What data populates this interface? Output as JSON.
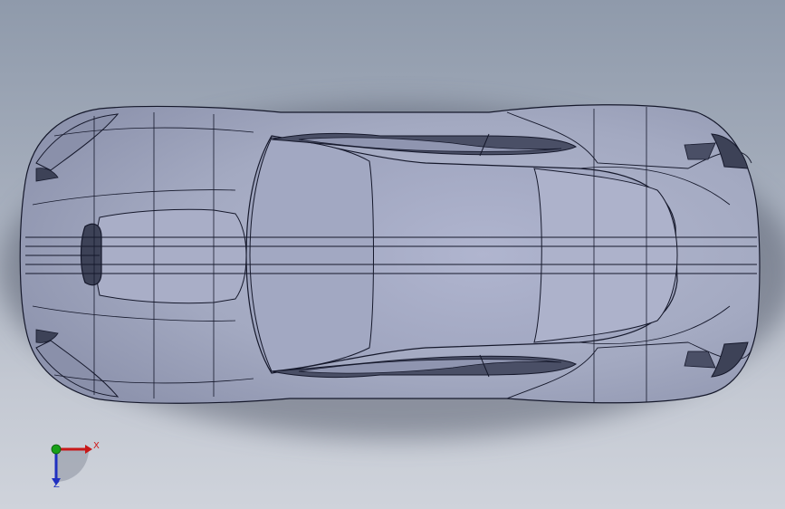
{
  "viewport": {
    "background_top": "#8f9aab",
    "background_bottom": "#cfd3db",
    "body_color": "#a7adc4",
    "edge_color": "#15182b"
  },
  "model": {
    "view": "top",
    "subject": "car-body"
  },
  "triad": {
    "x_label": "X",
    "z_label": "Z",
    "x_color": "#c81818",
    "y_color": "#18a018",
    "z_color": "#2030c0"
  }
}
